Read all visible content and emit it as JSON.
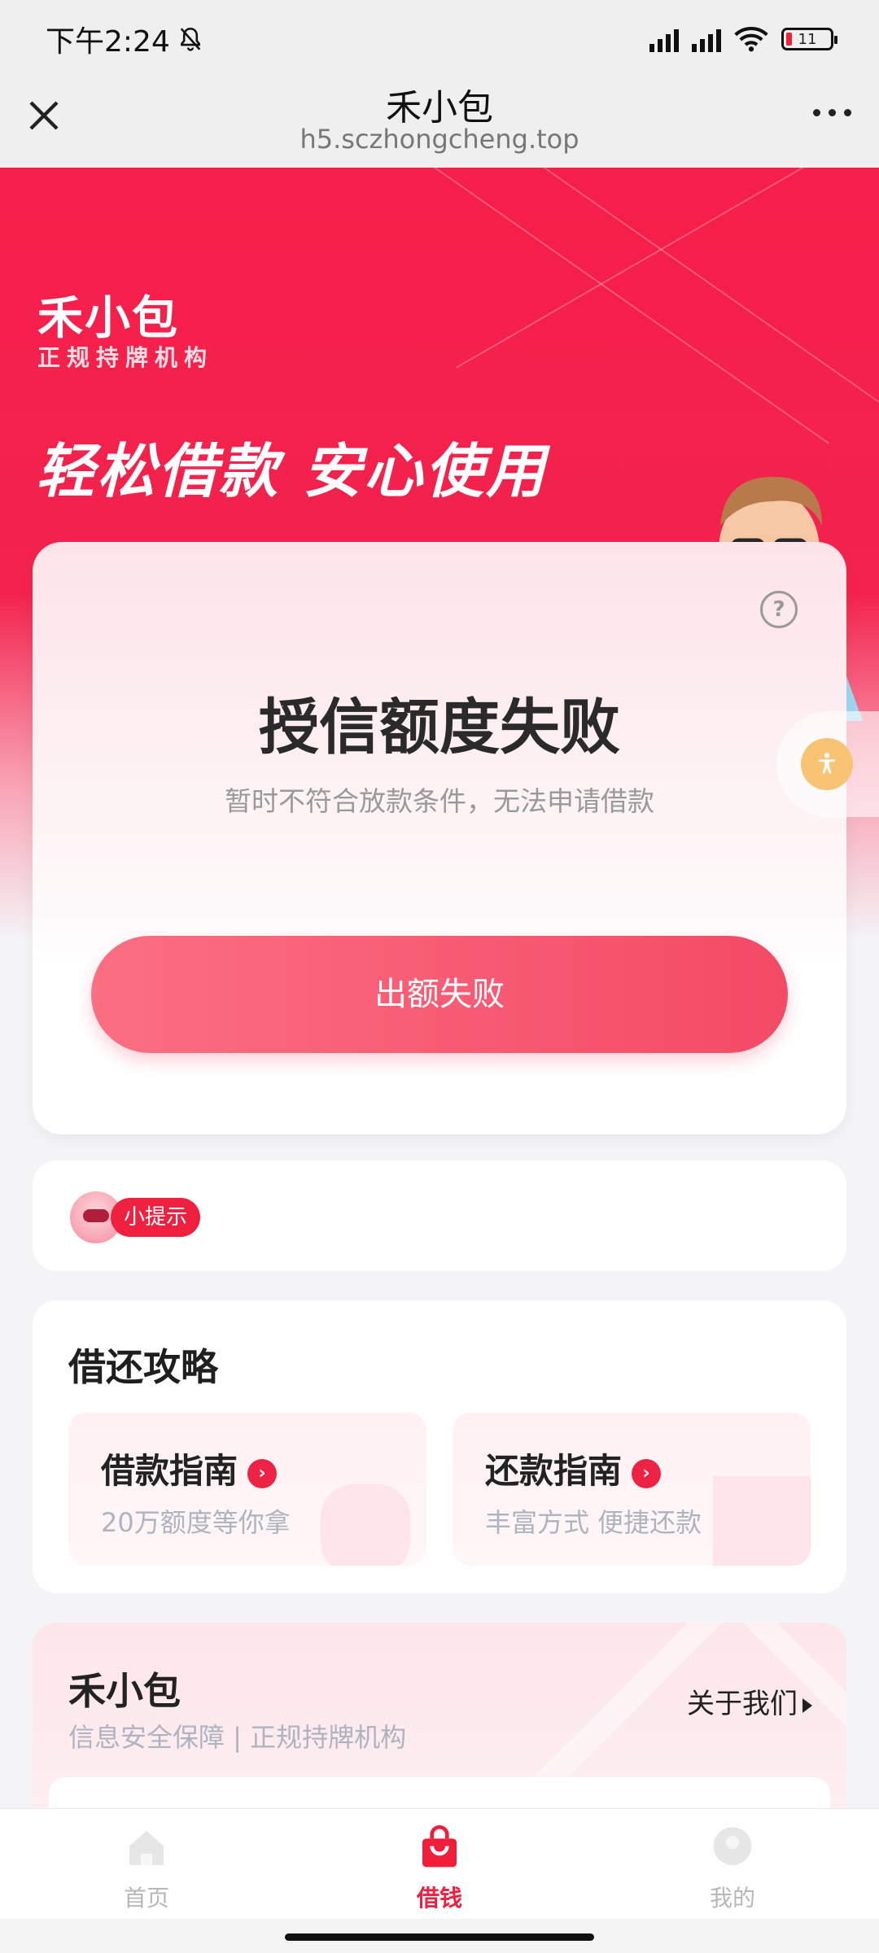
{
  "status_bar": {
    "time": "下午2:24",
    "battery": "11",
    "icons": [
      "mute-bell-icon",
      "signal-hd-icon",
      "signal-hd-icon",
      "wifi-icon",
      "battery-icon"
    ]
  },
  "nav": {
    "title": "禾小包",
    "url": "h5.sczhongcheng.top",
    "icons": [
      "close-icon",
      "more-icon"
    ]
  },
  "hero": {
    "brand": "禾小包",
    "brand_sub": "正规持牌机构",
    "slogan": "轻松借款 安心使用"
  },
  "credit_card": {
    "title": "授信额度失败",
    "subtitle": "暂时不符合放款条件，无法申请借款",
    "button_label": "出额失败",
    "icons": [
      "help-icon"
    ]
  },
  "float_button": {
    "icon": "accessibility-icon"
  },
  "tip": {
    "badge": "小提示"
  },
  "guide": {
    "title": "借还攻略",
    "items": [
      {
        "name": "借款指南",
        "desc": "20万额度等你拿"
      },
      {
        "name": "还款指南",
        "desc": "丰富方式 便捷还款"
      }
    ]
  },
  "about": {
    "title": "禾小包",
    "sub": "信息安全保障 | 正规持牌机构",
    "link": "关于我们"
  },
  "tabs": [
    {
      "label": "首页",
      "icon": "home-icon",
      "active": false
    },
    {
      "label": "借钱",
      "icon": "shopping-bag-icon",
      "active": true
    },
    {
      "label": "我的",
      "icon": "profile-icon",
      "active": false
    }
  ],
  "colors": {
    "brand_red": "#f41f4a",
    "button_start": "#fb6f82",
    "button_end": "#f44a66",
    "active_tab": "#ef1f3f"
  }
}
